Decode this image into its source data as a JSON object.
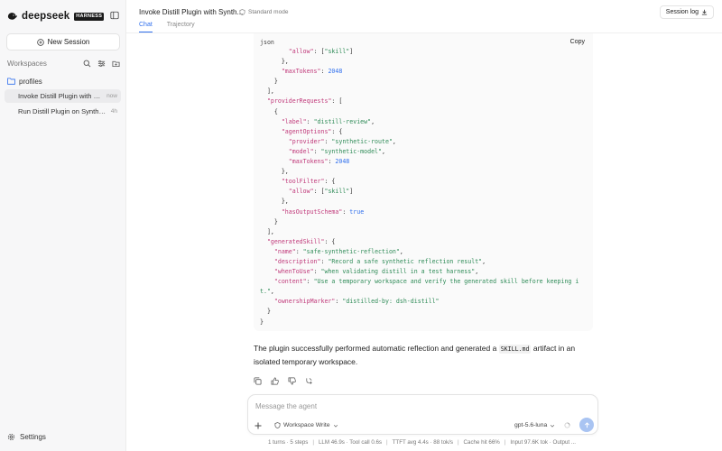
{
  "app": {
    "brand_name": "deepseek",
    "brand_badge": "HARNESS"
  },
  "sidebar": {
    "new_session_label": "New Session",
    "workspaces_label": "Workspaces",
    "folder_name": "profiles",
    "sessions": [
      {
        "title": "Invoke Distill Plugin with Sy...",
        "time": "now",
        "active": true
      },
      {
        "title": "Run Distill Plugin on Syntheti...",
        "time": "4h",
        "active": false
      }
    ],
    "settings_label": "Settings"
  },
  "header": {
    "title": "Invoke Distill Plugin with Synth...",
    "mode": "Standard mode",
    "tabs": [
      {
        "label": "Chat",
        "active": true
      },
      {
        "label": "Trajectory",
        "active": false
      }
    ],
    "session_log_label": "Session log"
  },
  "code_block": {
    "language": "json",
    "copy_label": "Copy",
    "lines": [
      [
        {
          "t": "        "
        },
        {
          "t": "\"allow\"",
          "c": "k"
        },
        {
          "t": ": ["
        },
        {
          "t": "\"skill\"",
          "c": "s"
        },
        {
          "t": "]"
        }
      ],
      [
        {
          "t": "      },"
        }
      ],
      [
        {
          "t": "      "
        },
        {
          "t": "\"maxTokens\"",
          "c": "k"
        },
        {
          "t": ": "
        },
        {
          "t": "2048",
          "c": "n"
        }
      ],
      [
        {
          "t": "    }"
        }
      ],
      [
        {
          "t": "  ],"
        }
      ],
      [
        {
          "t": "  "
        },
        {
          "t": "\"providerRequests\"",
          "c": "k"
        },
        {
          "t": ": ["
        }
      ],
      [
        {
          "t": "    {"
        }
      ],
      [
        {
          "t": "      "
        },
        {
          "t": "\"label\"",
          "c": "k"
        },
        {
          "t": ": "
        },
        {
          "t": "\"distill-review\"",
          "c": "s"
        },
        {
          "t": ","
        }
      ],
      [
        {
          "t": "      "
        },
        {
          "t": "\"agentOptions\"",
          "c": "k"
        },
        {
          "t": ": {"
        }
      ],
      [
        {
          "t": "        "
        },
        {
          "t": "\"provider\"",
          "c": "k"
        },
        {
          "t": ": "
        },
        {
          "t": "\"synthetic-route\"",
          "c": "s"
        },
        {
          "t": ","
        }
      ],
      [
        {
          "t": "        "
        },
        {
          "t": "\"model\"",
          "c": "k"
        },
        {
          "t": ": "
        },
        {
          "t": "\"synthetic-model\"",
          "c": "s"
        },
        {
          "t": ","
        }
      ],
      [
        {
          "t": "        "
        },
        {
          "t": "\"maxTokens\"",
          "c": "k"
        },
        {
          "t": ": "
        },
        {
          "t": "2048",
          "c": "n"
        }
      ],
      [
        {
          "t": "      },"
        }
      ],
      [
        {
          "t": "      "
        },
        {
          "t": "\"toolFilter\"",
          "c": "k"
        },
        {
          "t": ": {"
        }
      ],
      [
        {
          "t": "        "
        },
        {
          "t": "\"allow\"",
          "c": "k"
        },
        {
          "t": ": ["
        },
        {
          "t": "\"skill\"",
          "c": "s"
        },
        {
          "t": "]"
        }
      ],
      [
        {
          "t": "      },"
        }
      ],
      [
        {
          "t": "      "
        },
        {
          "t": "\"hasOutputSchema\"",
          "c": "k"
        },
        {
          "t": ": "
        },
        {
          "t": "true",
          "c": "n"
        }
      ],
      [
        {
          "t": "    }"
        }
      ],
      [
        {
          "t": "  ],"
        }
      ],
      [
        {
          "t": "  "
        },
        {
          "t": "\"generatedSkill\"",
          "c": "k"
        },
        {
          "t": ": {"
        }
      ],
      [
        {
          "t": "    "
        },
        {
          "t": "\"name\"",
          "c": "k"
        },
        {
          "t": ": "
        },
        {
          "t": "\"safe-synthetic-reflection\"",
          "c": "s"
        },
        {
          "t": ","
        }
      ],
      [
        {
          "t": "    "
        },
        {
          "t": "\"description\"",
          "c": "k"
        },
        {
          "t": ": "
        },
        {
          "t": "\"Record a safe synthetic reflection result\"",
          "c": "s"
        },
        {
          "t": ","
        }
      ],
      [
        {
          "t": "    "
        },
        {
          "t": "\"whenToUse\"",
          "c": "k"
        },
        {
          "t": ": "
        },
        {
          "t": "\"when validating distill in a test harness\"",
          "c": "s"
        },
        {
          "t": ","
        }
      ],
      [
        {
          "t": "    "
        },
        {
          "t": "\"content\"",
          "c": "k"
        },
        {
          "t": ": "
        },
        {
          "t": "\"Use a temporary workspace and verify the generated skill before keeping i",
          "c": "s"
        }
      ],
      [
        {
          "t": "t.\"",
          "c": "s"
        },
        {
          "t": ","
        }
      ],
      [
        {
          "t": "    "
        },
        {
          "t": "\"ownershipMarker\"",
          "c": "k"
        },
        {
          "t": ": "
        },
        {
          "t": "\"distilled-by: dsh-distill\"",
          "c": "s"
        }
      ],
      [
        {
          "t": "  }"
        }
      ],
      [
        {
          "t": "}"
        }
      ]
    ]
  },
  "reply": {
    "before": "The plugin successfully performed automatic reflection and generated a ",
    "code": "SKILL.md",
    "after": " artifact in an isolated temporary workspace."
  },
  "composer": {
    "placeholder": "Message the agent",
    "workspace_label": "Workspace Write",
    "model_label": "gpt-5.6-luna"
  },
  "status_bar": [
    "1 turns · 5 steps",
    "LLM 46.9s · Tool call 0.6s",
    "TTFT avg 4.4s · 88 tok/s",
    "Cache hit 66%",
    "Input 97.6K tok · Output ..."
  ],
  "colors": {
    "accent": "#2f6fed",
    "code_key": "#c0397a",
    "code_string": "#2e8b57",
    "code_number": "#2f6fed"
  }
}
